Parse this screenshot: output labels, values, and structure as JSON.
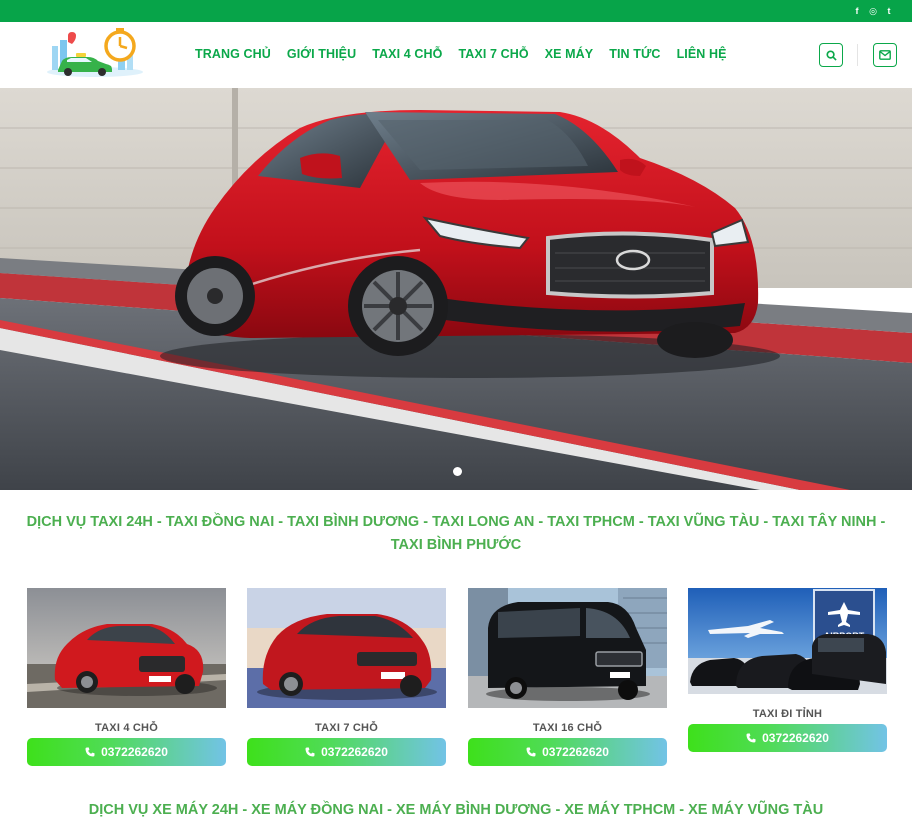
{
  "nav": {
    "items": [
      "TRANG CHỦ",
      "GIỚI THIỆU",
      "TAXI 4 CHỖ",
      "TAXI 7 CHỖ",
      "XE MÁY",
      "TIN TỨC",
      "LIÊN HỆ"
    ]
  },
  "social": {
    "facebook": "f",
    "instagram": "◎",
    "twitter": "t"
  },
  "headings": {
    "taxi": "DỊCH VỤ TAXI 24H - TAXI ĐỒNG NAI - TAXI BÌNH DƯƠNG - TAXI LONG AN - TAXI TPHCM - TAXI VŨNG TÀU - TAXI TÂY NINH - TAXI BÌNH PHƯỚC",
    "motorbike": "DỊCH VỤ XE MÁY 24H - XE MÁY ĐỒNG NAI - XE MÁY BÌNH DƯƠNG - XE MÁY TPHCM - XE MÁY VŨNG TÀU"
  },
  "cards": [
    {
      "label": "TAXI 4 CHỖ",
      "phone": "0372262620"
    },
    {
      "label": "TAXI 7 CHỖ",
      "phone": "0372262620"
    },
    {
      "label": "TAXI 16 CHỖ",
      "phone": "0372262620"
    },
    {
      "label": "TAXI ĐI TỈNH",
      "phone": "0372262620"
    }
  ],
  "images": {
    "card3_plate": "AIRPORT"
  },
  "colors": {
    "brand_green": "#07a449",
    "nav_green": "#0ba84a",
    "heading_green": "#4caf50",
    "car_red": "#c8101c"
  },
  "slider": {
    "active_dot": 1
  }
}
